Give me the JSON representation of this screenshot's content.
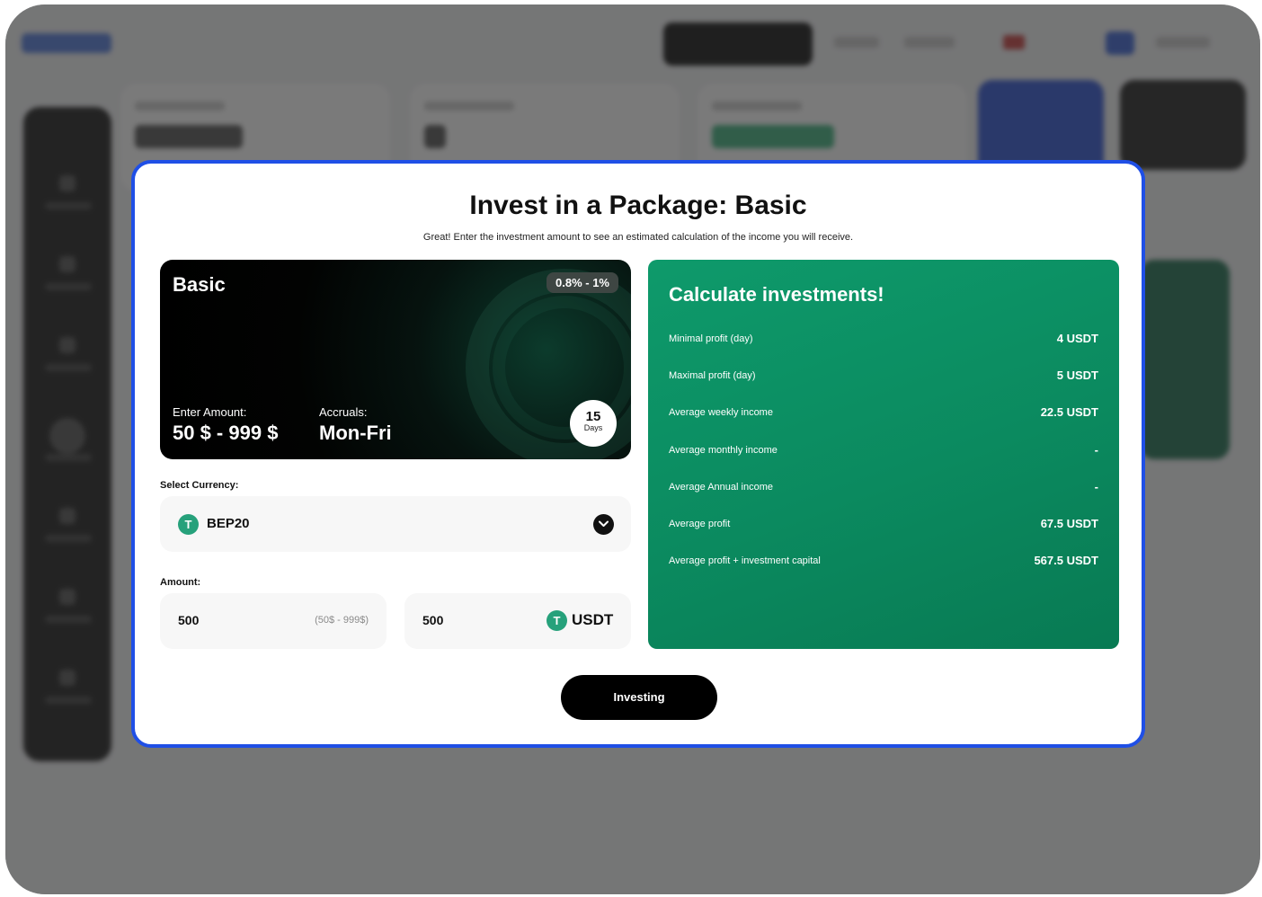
{
  "modal": {
    "title": "Invest in a Package: Basic",
    "subtitle": "Great! Enter the investment amount to see an estimated calculation of the income you will receive."
  },
  "package": {
    "name": "Basic",
    "rate": "0.8% - 1%",
    "enter_amount_label": "Enter Amount:",
    "enter_amount_value": "50 $ - 999 $",
    "accruals_label": "Accruals:",
    "accruals_value": "Mon-Fri",
    "duration_number": "15",
    "duration_unit": "Days"
  },
  "currency": {
    "label": "Select Currency:",
    "icon": "tether-icon",
    "selected": "BEP20"
  },
  "amount": {
    "label": "Amount:",
    "input_value": "500",
    "range_hint": "(50$ - 999$)",
    "converted_value": "500",
    "unit": "USDT"
  },
  "calculator": {
    "title": "Calculate investments!",
    "rows": [
      {
        "label": "Minimal profit (day)",
        "value": "4 USDT"
      },
      {
        "label": "Maximal profit (day)",
        "value": "5 USDT"
      },
      {
        "label": "Average weekly income",
        "value": "22.5 USDT"
      },
      {
        "label": "Average monthly income",
        "value": "-"
      },
      {
        "label": "Average Annual income",
        "value": "-"
      },
      {
        "label": "Average profit",
        "value": "67.5 USDT"
      },
      {
        "label": "Average profit + investment capital",
        "value": "567.5 USDT"
      }
    ]
  },
  "actions": {
    "invest_label": "Investing"
  },
  "colors": {
    "accent_border": "#1f4fe6",
    "calc_green": "#0b8a5f",
    "tether_green": "#26a17b"
  }
}
